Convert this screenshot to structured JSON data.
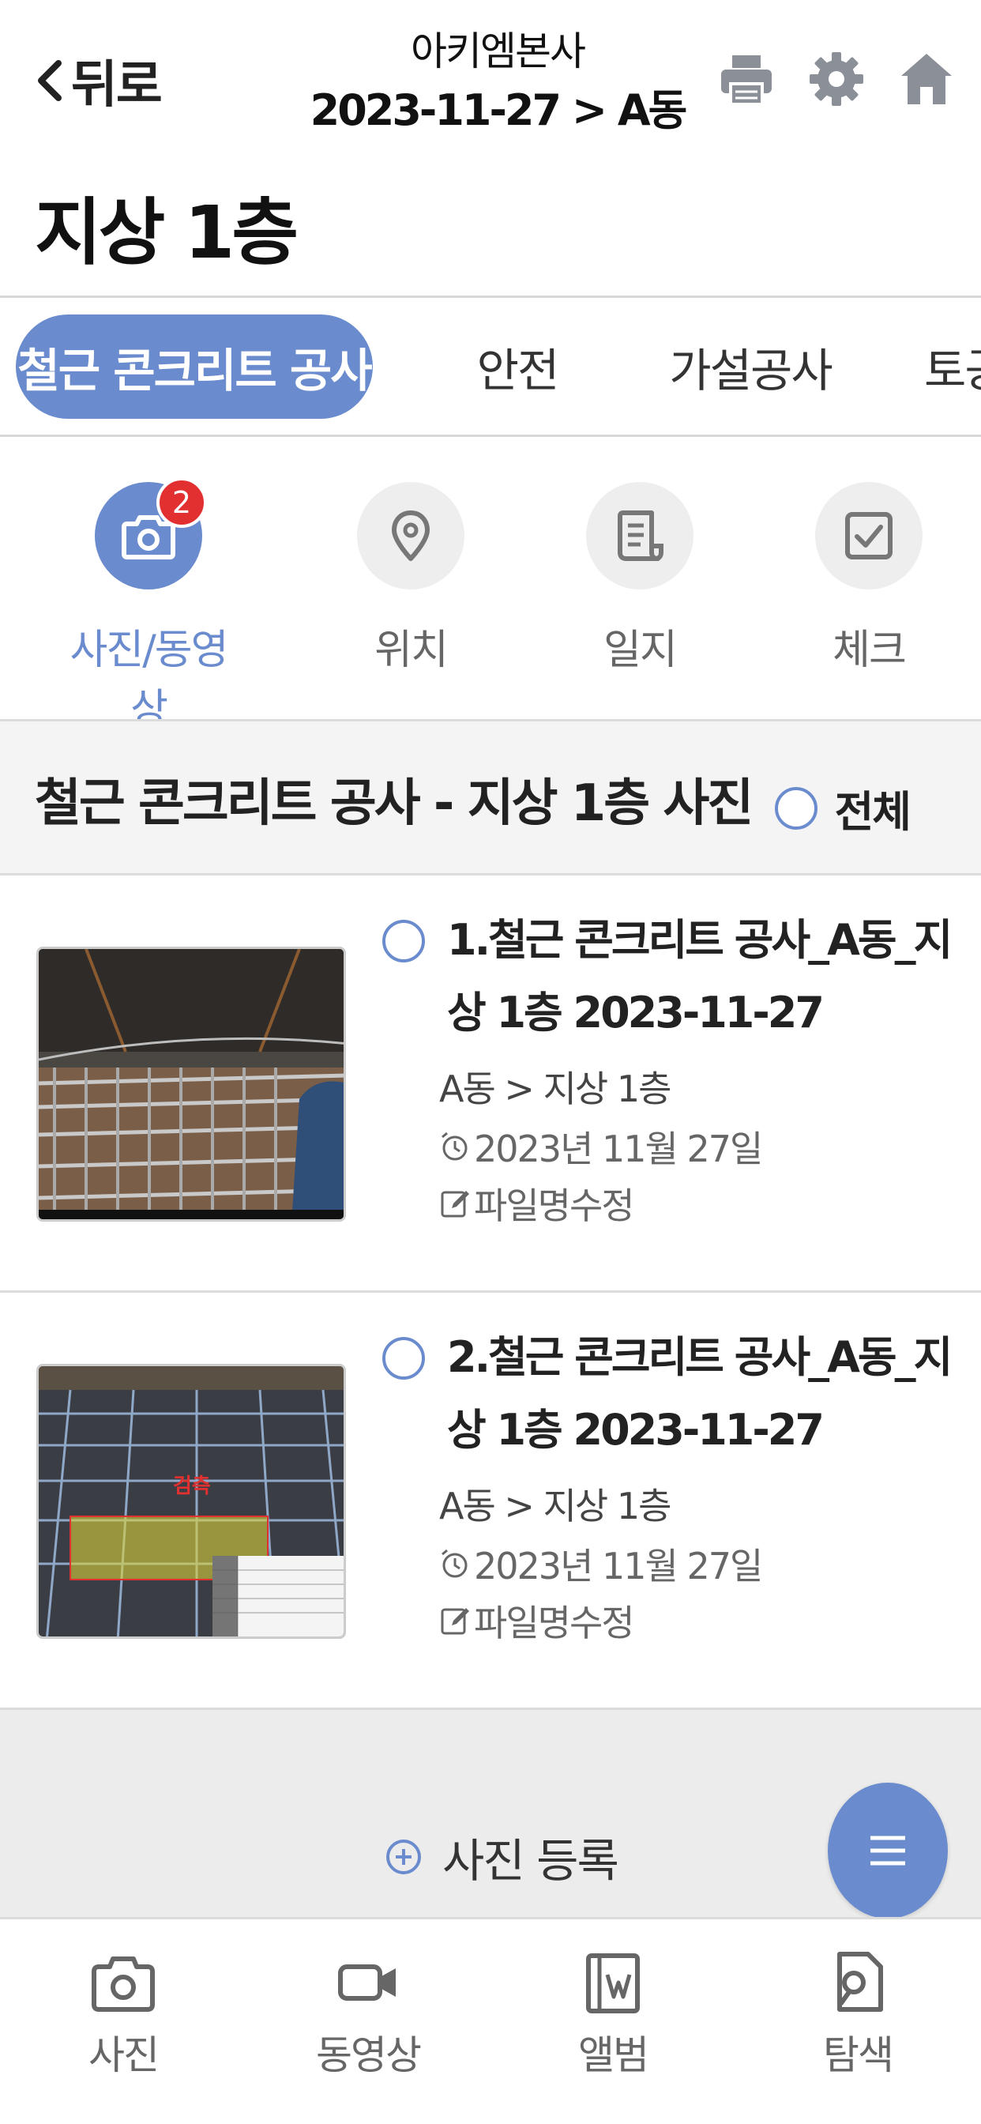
{
  "header": {
    "back_label": "뒤로",
    "company": "아키엠본사",
    "path": "2023-11-27 > A동",
    "icons": [
      "printer-icon",
      "gear-icon",
      "home-icon"
    ]
  },
  "page_title": "지상 1층",
  "tabs": [
    {
      "label": "철근 콘크리트 공사",
      "active": true
    },
    {
      "label": "안전",
      "active": false
    },
    {
      "label": "가설공사",
      "active": false
    },
    {
      "label": "토공",
      "active": false
    }
  ],
  "menu": [
    {
      "label": "사진/동영상",
      "icon": "camera-icon",
      "active": true,
      "badge": "2"
    },
    {
      "label": "위치",
      "icon": "location-pin-icon",
      "active": false
    },
    {
      "label": "일지",
      "icon": "document-icon",
      "active": false
    },
    {
      "label": "체크",
      "icon": "checkbox-icon",
      "active": false
    }
  ],
  "section": {
    "title": "철근 콘크리트 공사 - 지상 1층 사진",
    "select_all_label": "전체"
  },
  "items": [
    {
      "title": "1.철근 콘크리트 공사_A동_지상 1층 2023-11-27",
      "location": "A동 > 지상 1층",
      "date": "2023년 11월 27일",
      "edit_label": "파일명수정"
    },
    {
      "title": "2.철근 콘크리트 공사_A동_지상 1층 2023-11-27",
      "location": "A동 > 지상 1층",
      "date": "2023년 11월 27일",
      "edit_label": "파일명수정",
      "overlay_text": "검측"
    }
  ],
  "register_label": "사진 등록",
  "bottom_nav": [
    {
      "label": "사진",
      "icon": "camera-icon"
    },
    {
      "label": "동영상",
      "icon": "video-icon"
    },
    {
      "label": "앨범",
      "icon": "album-icon"
    },
    {
      "label": "탐색",
      "icon": "file-search-icon"
    }
  ],
  "colors": {
    "accent": "#6a8bcd",
    "badge": "#e23030",
    "icon_gray": "#8a8f98"
  }
}
